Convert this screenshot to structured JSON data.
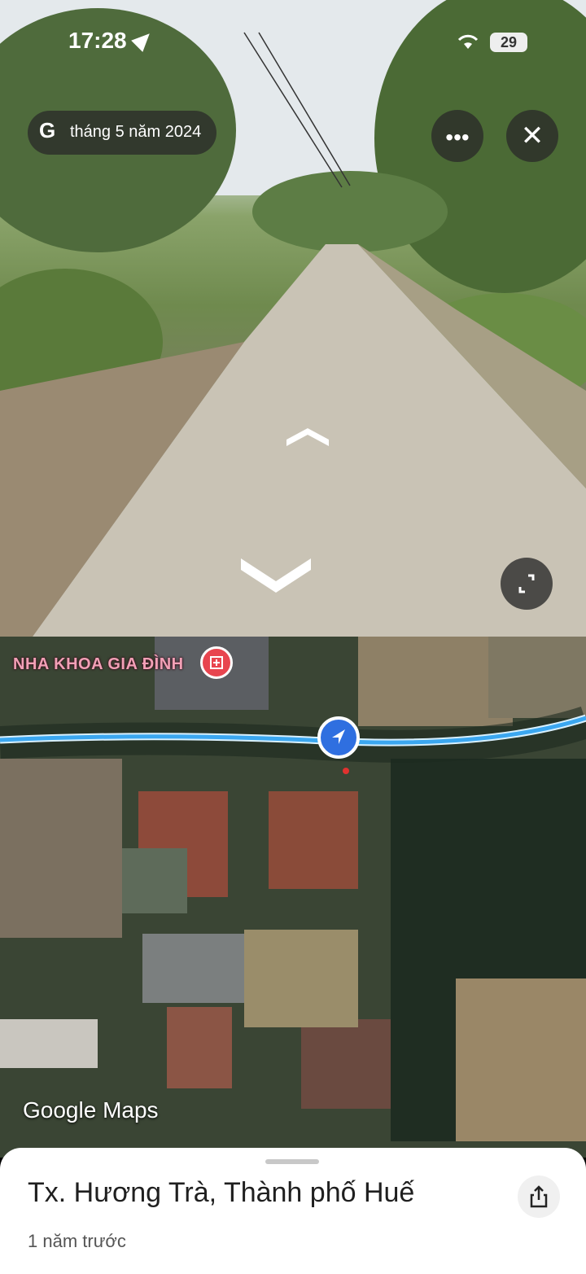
{
  "status_bar": {
    "time": "17:28",
    "battery": "29"
  },
  "street_view": {
    "date_label": "tháng 5 năm 2024",
    "more_icon": "more-horizontal-icon",
    "close_icon": "close-icon",
    "expand_icon": "expand-icon"
  },
  "map": {
    "poi_label": "NHA KHOA GIA ĐÌNH",
    "poi_icon": "dental-clinic-icon",
    "brand": "Google Maps"
  },
  "sheet": {
    "title": "Tx. Hương Trà, Thành phố Huế",
    "subtitle": "1 năm trước",
    "share_icon": "share-icon"
  }
}
